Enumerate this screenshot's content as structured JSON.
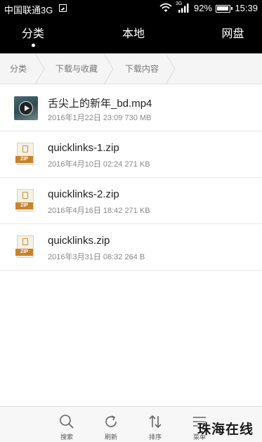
{
  "status_bar": {
    "carrier": "中国联通3G",
    "net_type": "3G",
    "battery": "92%",
    "time": "15:39"
  },
  "tabs": [
    {
      "label": "分类",
      "active": true
    },
    {
      "label": "本地",
      "active": false
    },
    {
      "label": "网盘",
      "active": false
    }
  ],
  "breadcrumb": [
    "分类",
    "下载与收藏",
    "下载内容"
  ],
  "files": [
    {
      "name": "舌尖上的新年_bd.mp4",
      "meta": "2016年1月22日 23:09 730 MB",
      "icon": "video-thumbnail-icon"
    },
    {
      "name": "quicklinks-1.zip",
      "meta": "2016年4月10日 02:24 271 KB",
      "icon": "zip-file-icon",
      "badge": "ZIP"
    },
    {
      "name": "quicklinks-2.zip",
      "meta": "2016年4月16日 18:42 271 KB",
      "icon": "zip-file-icon",
      "badge": "ZIP"
    },
    {
      "name": "quicklinks.zip",
      "meta": "2016年3月31日 08:32 264 B",
      "icon": "zip-file-icon",
      "badge": "ZIP"
    }
  ],
  "toolbar": {
    "search": "搜索",
    "refresh": "刷新",
    "sort": "排序",
    "menu": "菜单"
  },
  "watermark": "珠海在线",
  "colors": {
    "header_bg": "#000000",
    "breadcrumb_bg": "#f5f5f5",
    "zip_band": "#c9822b"
  }
}
